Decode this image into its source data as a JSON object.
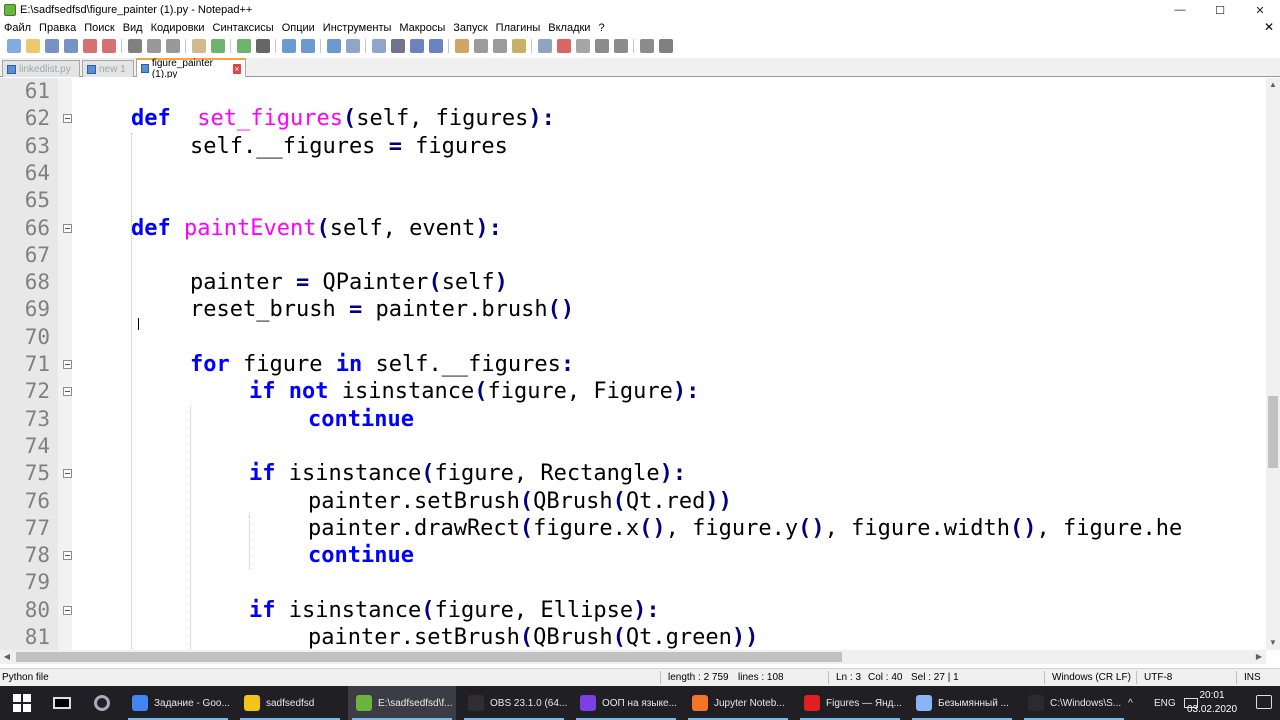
{
  "window": {
    "title": "E:\\sadfsedfsd\\figure_painter (1).py - Notepad++",
    "minimize": "—",
    "maximize": "☐",
    "close": "✕"
  },
  "menu": {
    "items": [
      "Файл",
      "Правка",
      "Поиск",
      "Вид",
      "Кодировки",
      "Синтаксисы",
      "Опции",
      "Инструменты",
      "Макросы",
      "Запуск",
      "Плагины",
      "Вкладки",
      "?"
    ],
    "close_doc": "✕"
  },
  "toolbar": {
    "icons": [
      "new-file-icon",
      "open-file-icon",
      "save-icon",
      "save-all-icon",
      "close-icon",
      "close-all-icon",
      "print-icon",
      "cut-icon",
      "copy-icon",
      "paste-icon",
      "undo-icon",
      "redo-icon",
      "find-icon",
      "replace-icon",
      "zoom-in-icon",
      "zoom-out-icon",
      "sync-v-icon",
      "sync-h-icon",
      "wrap-icon",
      "all-chars-icon",
      "indent-guide-icon",
      "udl-icon",
      "doc-map-icon",
      "function-list-icon",
      "folder-workspace-icon",
      "monitor-icon",
      "record-macro-icon",
      "stop-macro-icon",
      "play-macro-icon",
      "run-macro-multiple-icon",
      "save-macro-icon",
      "spellcheck-icon"
    ]
  },
  "tabs": [
    {
      "label": "linkedlist.py",
      "active": false
    },
    {
      "label": "new 1",
      "active": false
    },
    {
      "label": "figure_painter (1).py",
      "active": true
    }
  ],
  "editor": {
    "lines": [
      {
        "n": "61",
        "fold": false,
        "indent": 0,
        "tokens": []
      },
      {
        "n": "62",
        "fold": true,
        "indent": 0,
        "tokens": [
          [
            "kw",
            "def"
          ],
          [
            "",
            "  "
          ],
          [
            "fn",
            "set_figures"
          ],
          [
            "op",
            "("
          ],
          [
            "",
            "self, figures"
          ],
          [
            "op",
            ")"
          ],
          [
            "op",
            ":"
          ]
        ]
      },
      {
        "n": "63",
        "fold": false,
        "indent": 1,
        "tokens": [
          [
            "",
            "self.__figures "
          ],
          [
            "op",
            "="
          ],
          [
            "",
            " figures"
          ]
        ]
      },
      {
        "n": "64",
        "fold": false,
        "indent": 0,
        "tokens": []
      },
      {
        "n": "65",
        "fold": false,
        "indent": 0,
        "tokens": []
      },
      {
        "n": "66",
        "fold": true,
        "indent": 0,
        "tokens": [
          [
            "kw",
            "def"
          ],
          [
            "",
            " "
          ],
          [
            "fn",
            "paintEvent"
          ],
          [
            "op",
            "("
          ],
          [
            "",
            "self, event"
          ],
          [
            "op",
            ")"
          ],
          [
            "op",
            ":"
          ]
        ]
      },
      {
        "n": "67",
        "fold": false,
        "indent": 0,
        "tokens": []
      },
      {
        "n": "68",
        "fold": false,
        "indent": 1,
        "tokens": [
          [
            "",
            "painter "
          ],
          [
            "op",
            "="
          ],
          [
            "",
            " QPainter"
          ],
          [
            "op",
            "("
          ],
          [
            "",
            "self"
          ],
          [
            "op",
            ")"
          ]
        ]
      },
      {
        "n": "69",
        "fold": false,
        "indent": 1,
        "tokens": [
          [
            "",
            "reset_brush "
          ],
          [
            "op",
            "="
          ],
          [
            "",
            " painter.brush"
          ],
          [
            "op",
            "()"
          ]
        ]
      },
      {
        "n": "70",
        "fold": false,
        "indent": 0,
        "tokens": []
      },
      {
        "n": "71",
        "fold": true,
        "indent": 1,
        "tokens": [
          [
            "kw",
            "for"
          ],
          [
            "",
            " figure "
          ],
          [
            "kw",
            "in"
          ],
          [
            "",
            " self.__figures"
          ],
          [
            "op",
            ":"
          ]
        ]
      },
      {
        "n": "72",
        "fold": true,
        "indent": 2,
        "tokens": [
          [
            "kw",
            "if"
          ],
          [
            "",
            " "
          ],
          [
            "kw",
            "not"
          ],
          [
            "",
            " isinstance"
          ],
          [
            "op",
            "("
          ],
          [
            "",
            "figure, Figure"
          ],
          [
            "op",
            ")"
          ],
          [
            "op",
            ":"
          ]
        ]
      },
      {
        "n": "73",
        "fold": false,
        "indent": 3,
        "tokens": [
          [
            "kw",
            "continue"
          ]
        ]
      },
      {
        "n": "74",
        "fold": false,
        "indent": 0,
        "tokens": []
      },
      {
        "n": "75",
        "fold": true,
        "indent": 2,
        "tokens": [
          [
            "kw",
            "if"
          ],
          [
            "",
            " isinstance"
          ],
          [
            "op",
            "("
          ],
          [
            "",
            "figure, Rectangle"
          ],
          [
            "op",
            ")"
          ],
          [
            "op",
            ":"
          ]
        ]
      },
      {
        "n": "76",
        "fold": false,
        "indent": 3,
        "tokens": [
          [
            "",
            "painter.setBrush"
          ],
          [
            "op",
            "("
          ],
          [
            "",
            "QBrush"
          ],
          [
            "op",
            "("
          ],
          [
            "",
            "Qt.red"
          ],
          [
            "op",
            "))"
          ]
        ]
      },
      {
        "n": "77",
        "fold": false,
        "indent": 3,
        "tokens": [
          [
            "",
            "painter.drawRect"
          ],
          [
            "op",
            "("
          ],
          [
            "",
            "figure.x"
          ],
          [
            "op",
            "()"
          ],
          [
            "",
            ", figure.y"
          ],
          [
            "op",
            "()"
          ],
          [
            "",
            ", figure.width"
          ],
          [
            "op",
            "()"
          ],
          [
            "",
            ", figure.he"
          ]
        ]
      },
      {
        "n": "78",
        "fold": true,
        "indent": 3,
        "tokens": [
          [
            "kw",
            "continue"
          ]
        ]
      },
      {
        "n": "79",
        "fold": false,
        "indent": 0,
        "tokens": []
      },
      {
        "n": "80",
        "fold": true,
        "indent": 2,
        "tokens": [
          [
            "kw",
            "if"
          ],
          [
            "",
            " isinstance"
          ],
          [
            "op",
            "("
          ],
          [
            "",
            "figure, Ellipse"
          ],
          [
            "op",
            ")"
          ],
          [
            "op",
            ":"
          ]
        ]
      },
      {
        "n": "81",
        "fold": false,
        "indent": 3,
        "tokens": [
          [
            "",
            "painter.setBrush"
          ],
          [
            "op",
            "("
          ],
          [
            "",
            "QBrush"
          ],
          [
            "op",
            "("
          ],
          [
            "",
            "Qt.green"
          ],
          [
            "op",
            "))"
          ]
        ]
      }
    ]
  },
  "statusbar": {
    "language": "Python file",
    "length": "length : 2 759",
    "lines": "lines : 108",
    "position": "Ln : 3",
    "column": "Col : 40",
    "selection": "Sel : 27 | 1",
    "eol": "Windows (CR LF)",
    "encoding": "UTF-8",
    "mode": "INS"
  },
  "taskbar": {
    "items": [
      {
        "label": "Задание - Goo...",
        "color": "#4285f4"
      },
      {
        "label": "sadfsedfsd",
        "color": "#f0c419"
      },
      {
        "label": "E:\\sadfsedfsd\\f...",
        "color": "#6db33f"
      },
      {
        "label": "OBS 23.1.0 (64...",
        "color": "#302e31"
      },
      {
        "label": "ООП на языке...",
        "color": "#7b3fe4"
      },
      {
        "label": "Jupyter Noteb...",
        "color": "#f37626"
      },
      {
        "label": "Figures — Янд...",
        "color": "#e02020"
      },
      {
        "label": "Безымянный ...",
        "color": "#8ab4f8"
      },
      {
        "label": "C:\\Windows\\S...",
        "color": "#2b2b2b"
      }
    ],
    "lang": "ENG",
    "time": "20:01",
    "date": "03.02.2020",
    "tray_chevron": "^"
  }
}
